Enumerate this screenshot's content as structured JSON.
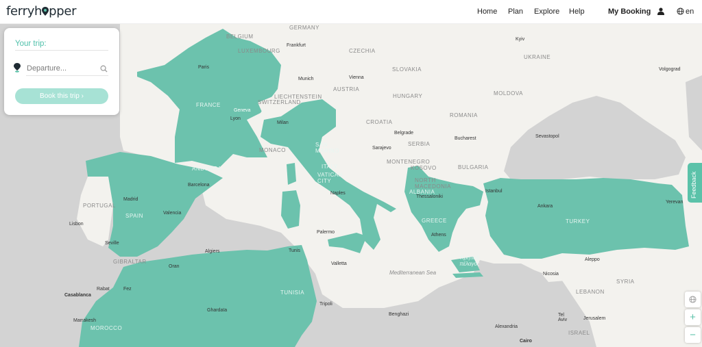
{
  "brand": {
    "logo_text_left": "ferryh",
    "logo_text_right": "pper"
  },
  "nav": {
    "home": "Home",
    "plan": "Plan",
    "explore": "Explore",
    "help": "Help",
    "my_booking": "My Booking",
    "lang": "en"
  },
  "trip_panel": {
    "title": "Your trip:",
    "departure_placeholder": "Departure...",
    "book_button": "Book this trip ›"
  },
  "feedback_tab": "Feedback",
  "map_labels": {
    "countries": [
      "BELGIUM",
      "GERMANY",
      "LUXEMBOURG",
      "CZECHIA",
      "SLOVAKIA",
      "AUSTRIA",
      "UKRAINE",
      "HUNGARY",
      "MOLDOVA",
      "LIECHTENSTEIN",
      "SWITZERLAND",
      "FRANCE",
      "ROMANIA",
      "CROATIA",
      "SERBIA",
      "SAN MARINO",
      "MONACO",
      "ANDORRA",
      "ITALY",
      "VATICAN CITY",
      "MONTENEGRO",
      "KOSOVO",
      "BULGARIA",
      "NORTH MACEDONIA",
      "ALBANIA",
      "PORTUGAL",
      "SPAIN",
      "GREECE",
      "TURKEY",
      "GIBRALTAR",
      "TUNISIA",
      "MOROCCO",
      "SYRIA",
      "LEBANON",
      "ISRAEL"
    ],
    "cities": [
      "Frankfurt",
      "Kyiv",
      "Paris",
      "Munich",
      "Vienna",
      "Volgograd",
      "Geneva",
      "Lyon",
      "Milan",
      "Sevastopol",
      "Belgrade",
      "Bucharest",
      "Sarajevo",
      "Barcelona",
      "Naples",
      "Istanbul",
      "Madrid",
      "Thessaloniki",
      "Ankara",
      "Yerevan",
      "Valencia",
      "Lisbon",
      "Athens",
      "Palermo",
      "Seville",
      "Algiers",
      "Tunis",
      "Aleppo",
      "Oran",
      "Valletta",
      "Nicosia",
      "Rabat",
      "Fez",
      "Casablanca",
      "Tripoli",
      "Ghardaïa",
      "Tel Aviv",
      "Jerusalem",
      "Marrakesh",
      "Benghazi",
      "Alexandria",
      "Cairo"
    ],
    "sea": "Mediterranean Sea",
    "crete": "Κρητικό πέλαγος"
  },
  "colors": {
    "accent": "#5bc2a9",
    "land_highlight": "#6cc2ad",
    "land_other": "#f4f3f0",
    "water": "#d3d3d3"
  },
  "icons": {
    "user": "user-icon",
    "globe": "globe-icon",
    "search": "search-icon",
    "pin": "pin-icon",
    "layers": "layers-icon",
    "zoom_in": "zoom-in-icon",
    "zoom_out": "zoom-out-icon"
  }
}
